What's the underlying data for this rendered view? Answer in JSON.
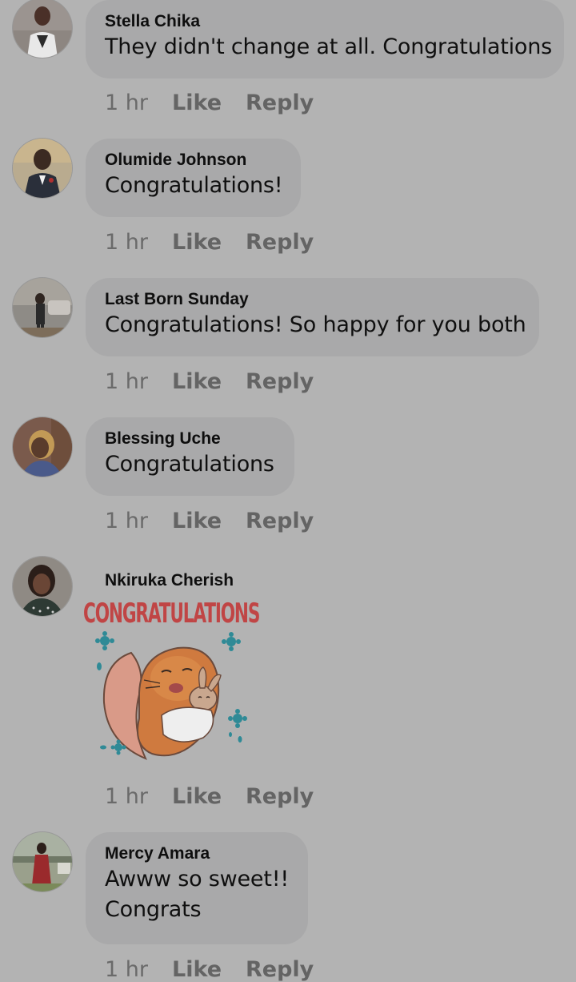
{
  "comments": [
    {
      "author": "Stella Chika",
      "text_lines": [
        "They didn't change at all. Congratulations"
      ],
      "time": "1 hr",
      "like": "Like",
      "reply": "Reply"
    },
    {
      "author": "Olumide Johnson",
      "text_lines": [
        "Congratulations!"
      ],
      "time": "1 hr",
      "like": "Like",
      "reply": "Reply"
    },
    {
      "author": "Last Born Sunday",
      "text_lines": [
        "Congratulations! So happy for you both"
      ],
      "time": "1 hr",
      "like": "Like",
      "reply": "Reply"
    },
    {
      "author": "Blessing Uche",
      "text_lines": [
        "Congratulations"
      ],
      "time": "1 hr",
      "like": "Like",
      "reply": "Reply"
    },
    {
      "author": "Nkiruka Cherish",
      "sticker": {
        "title": "CONGRATULATIONS",
        "icon": "bunny-hug-sticker"
      },
      "time": "1 hr",
      "like": "Like",
      "reply": "Reply"
    },
    {
      "author": "Mercy Amara",
      "text_lines": [
        "Awww so sweet!!",
        "Congrats"
      ],
      "time": "1 hr",
      "like": "Like",
      "reply": "Reply"
    }
  ],
  "colors": {
    "background": "#b3b3b3",
    "bubble": "#a9a9aa",
    "action_text": "#646464",
    "sticker_title": "#c04545"
  }
}
